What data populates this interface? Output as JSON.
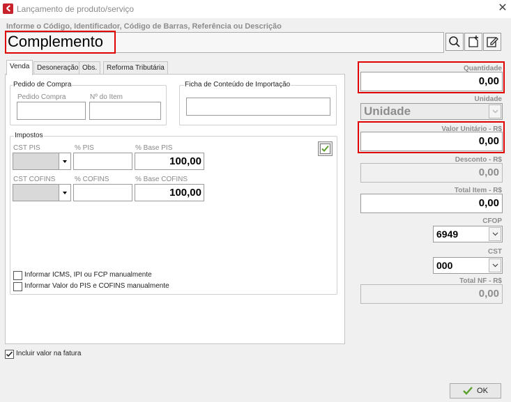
{
  "window": {
    "title": "Lançamento de produto/serviço",
    "close_glyph": "✕"
  },
  "search": {
    "hint": "Informe o Código, Identificador, Código de Barras, Referência ou Descrição",
    "value": "Complemento"
  },
  "toolbar": {
    "icons": [
      "search-icon",
      "new-item-icon",
      "edit-icon"
    ]
  },
  "tabs": [
    "Venda",
    "Desoneração",
    "Obs.",
    "Reforma Tributária"
  ],
  "pedido": {
    "group_label": "Pedido de Compra",
    "pedido_label": "Pedido Compra",
    "item_label": "Nº do Item"
  },
  "ficha": {
    "group_label": "Ficha de Conteúdo de Importação"
  },
  "impostos": {
    "group_label": "Impostos",
    "cst_pis_label": "CST PIS",
    "pct_pis_label": "% PIS",
    "base_pis_label": "% Base PIS",
    "base_pis_value": "100,00",
    "cst_cofins_label": "CST COFINS",
    "pct_cofins_label": "% COFINS",
    "base_cofins_label": "% Base COFINS",
    "base_cofins_value": "100,00"
  },
  "checkboxes": {
    "icms": "Informar ICMS, IPI ou FCP manualmente",
    "pis_cofins": "Informar Valor do PIS e COFINS manualmente",
    "incluir": "Incluir valor na fatura"
  },
  "right": {
    "quantidade_label": "Quantidade",
    "quantidade_value": "0,00",
    "unidade_label": "Unidade",
    "unidade_value": "Unidade",
    "valor_unit_label": "Valor Unitário - R$",
    "valor_unit_value": "0,00",
    "desconto_label": "Desconto - R$",
    "desconto_value": "0,00",
    "total_item_label": "Total Item - R$",
    "total_item_value": "0,00",
    "cfop_label": "CFOP",
    "cfop_value": "6949",
    "cst_label": "CST",
    "cst_value": "000",
    "total_nf_label": "Total NF - R$",
    "total_nf_value": "0,00"
  },
  "ok_button": {
    "label": "OK"
  },
  "colors": {
    "highlight": "#e00000",
    "check_green": "#5aa02c",
    "brand_red": "#c8232c"
  }
}
